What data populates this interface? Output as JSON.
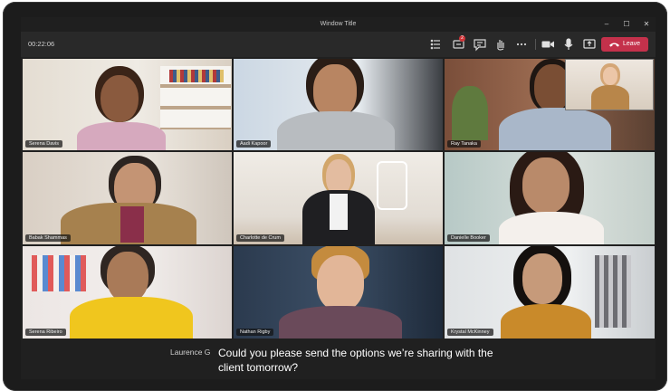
{
  "window": {
    "title": "Window Title",
    "minimize_glyph": "–",
    "maximize_glyph": "☐",
    "close_glyph": "✕"
  },
  "toolbar": {
    "timer": "00:22:06",
    "icons": [
      "participants-icon",
      "chat-icon",
      "reactions-icon",
      "raise-hand-icon",
      "more-icon",
      "camera-icon",
      "microphone-icon",
      "share-icon"
    ],
    "notification_badge": "2",
    "leave_label": "Leave",
    "leave_color": "#c4314b"
  },
  "participants": [
    {
      "name": "Serena Davis"
    },
    {
      "name": "Aadi Kapoor"
    },
    {
      "name": "Ray Tanaka"
    },
    {
      "name": "Babak Shammas"
    },
    {
      "name": "Charlotte de Crum"
    },
    {
      "name": "Danielle Booker"
    },
    {
      "name": "Serena Ribeiro"
    },
    {
      "name": "Nathan Rigby"
    },
    {
      "name": "Krystal McKinney"
    }
  ],
  "caption": {
    "speaker": "Laurence G",
    "text": "Could you please send the options we’re sharing with the client tomorrow?"
  }
}
